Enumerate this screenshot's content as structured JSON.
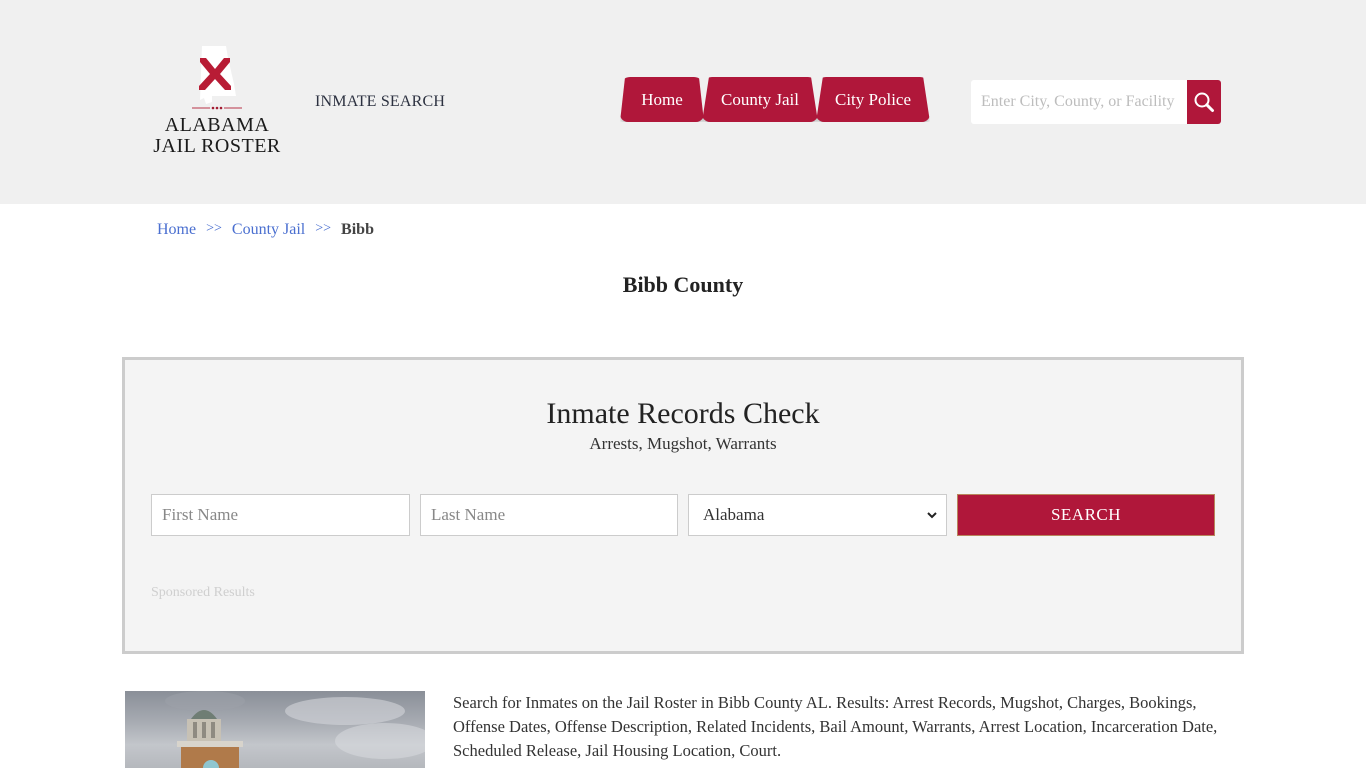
{
  "header": {
    "logo_line1": "ALABAMA",
    "logo_line2": "JAIL ROSTER",
    "inmate_search_link": "INMATE SEARCH",
    "nav": [
      {
        "label": "Home"
      },
      {
        "label": "County Jail"
      },
      {
        "label": "City Police"
      }
    ],
    "search": {
      "placeholder": "Enter City, County, or Facility",
      "icon": "search-icon"
    },
    "accent_color": "#b0173a"
  },
  "breadcrumb": {
    "items": [
      "Home",
      "County Jail"
    ],
    "separator": ">>",
    "current": "Bibb"
  },
  "page_title": "Bibb County",
  "records_panel": {
    "title": "Inmate Records Check",
    "subtitle": "Arrests, Mugshot, Warrants",
    "first_name_placeholder": "First Name",
    "last_name_placeholder": "Last Name",
    "state_selected": "Alabama",
    "search_button": "SEARCH",
    "sponsored_label": "Sponsored Results"
  },
  "intro": {
    "image_alt": "Bibb County courthouse clock tower",
    "text": "Search for Inmates on the Jail Roster in Bibb County AL. Results: Arrest Records, Mugshot, Charges, Bookings, Offense Dates, Offense Description, Related Incidents, Bail Amount, Warrants, Arrest Location, Incarceration Date, Scheduled Release, Jail Housing Location, Court."
  }
}
